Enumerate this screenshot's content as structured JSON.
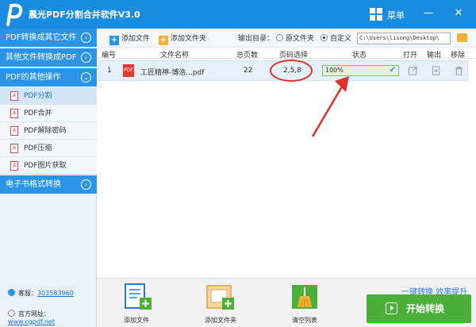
{
  "app": {
    "title": "晨光PDF分割合并软件V3.0",
    "menu_label": "菜单",
    "colors": {
      "brand": "#1a8ce0",
      "start": "#4caf3a",
      "annotation": "#e0302a"
    }
  },
  "sidebar": {
    "categories": [
      {
        "label": "PDF转换成其它文件"
      },
      {
        "label": "其他文件转换成PDF"
      },
      {
        "label": "PDF的其他操作"
      },
      {
        "label": "电子书格式转换"
      }
    ],
    "items": [
      {
        "label": "PDF分割"
      },
      {
        "label": "PDF合并"
      },
      {
        "label": "PDF解除密码"
      },
      {
        "label": "PDF压缩"
      },
      {
        "label": "PDF图片获取"
      }
    ],
    "footer": {
      "qq_label": "客服：",
      "qq_value": "303583960",
      "web_label": "官方网址：",
      "web_value": "www.cgpdf.net"
    }
  },
  "toolbar": {
    "add_file": "添加文件",
    "add_folder": "添加文件夹",
    "output_label": "输出目录：",
    "radio_original": "原文件夹",
    "radio_custom": "自定义",
    "output_path": "C:\\Users\\lisong\\Desktop\\"
  },
  "table": {
    "headers": {
      "index": "编号",
      "name": "文件名称",
      "total": "总页数",
      "pages": "页码选择",
      "status": "状态",
      "open": "打开",
      "output": "输出",
      "remove": "移除"
    },
    "rows": [
      {
        "index": "1",
        "name": "工匠精神-博浩...pdf",
        "total": "22",
        "pages": "2,5,8",
        "status": "100%",
        "progress": 1.0
      }
    ]
  },
  "bottom": {
    "add_file": "添加文件",
    "add_folder": "添加文件夹",
    "clear_list": "清空列表",
    "slogan": "一键转换  效率提升",
    "start": "开始转换"
  }
}
